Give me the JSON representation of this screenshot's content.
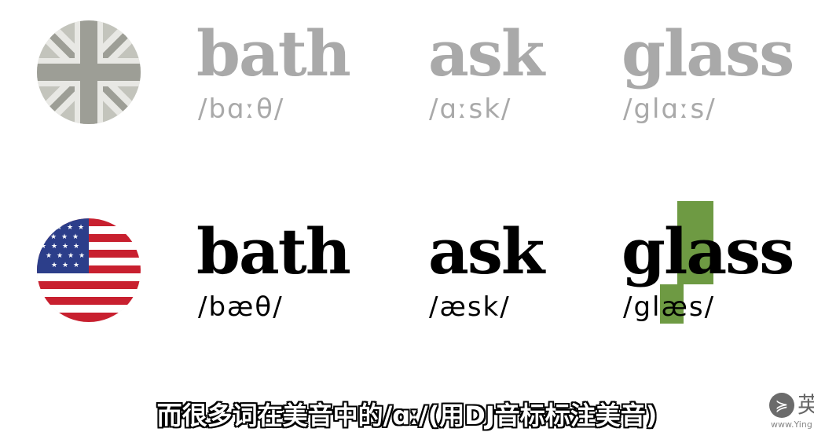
{
  "uk": {
    "words": [
      {
        "word": "bath",
        "ipa": "/bɑːθ/"
      },
      {
        "word": "ask",
        "ipa": "/ɑːsk/"
      },
      {
        "word": "glass",
        "ipa": "/glɑːs/"
      }
    ]
  },
  "us": {
    "words": [
      {
        "word": "bath",
        "ipa": "/bæθ/"
      },
      {
        "word": "ask",
        "ipa": "/æsk/"
      },
      {
        "word": "glass",
        "ipa": "/glæs/"
      }
    ]
  },
  "subtitle": "而很多词在美音中的/ɑː/(用DJ音标标注美音)",
  "logo": {
    "icon": "ying-logo-icon",
    "text": "英",
    "url": "www.Ying"
  },
  "colors": {
    "highlight": "#6e9a43",
    "uk_text": "#a9a9a9",
    "us_text": "#000000"
  }
}
